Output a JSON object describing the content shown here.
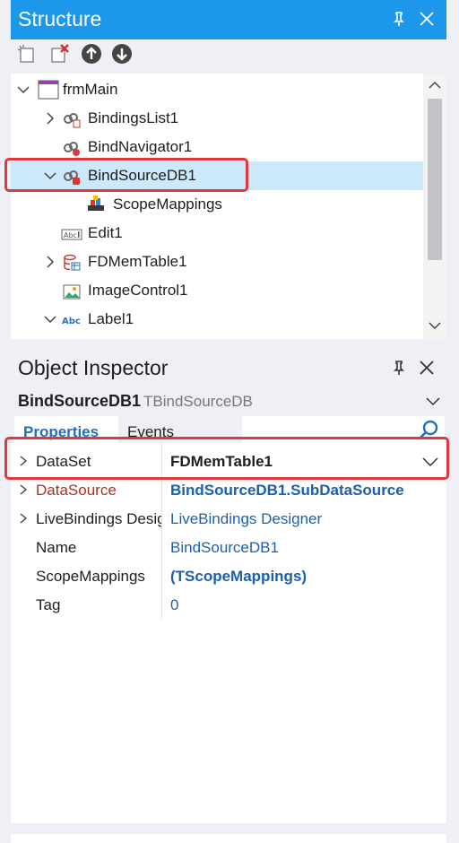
{
  "structure": {
    "title": "Structure",
    "tree": [
      {
        "label": "frmMain"
      },
      {
        "label": "BindingsList1"
      },
      {
        "label": "BindNavigator1"
      },
      {
        "label": "BindSourceDB1"
      },
      {
        "label": "ScopeMappings"
      },
      {
        "label": "Edit1"
      },
      {
        "label": "FDMemTable1"
      },
      {
        "label": "ImageControl1"
      },
      {
        "label": "Label1"
      }
    ]
  },
  "inspector": {
    "title": "Object Inspector",
    "object_name": "BindSourceDB1",
    "object_type": "TBindSourceDB",
    "tabs": {
      "properties": "Properties",
      "events": "Events"
    },
    "properties": [
      {
        "name": "DataSet",
        "value": "FDMemTable1"
      },
      {
        "name": "DataSource",
        "value": "BindSourceDB1.SubDataSource"
      },
      {
        "name": "LiveBindings Designer",
        "value": "LiveBindings Designer"
      },
      {
        "name": "Name",
        "value": "BindSourceDB1"
      },
      {
        "name": "ScopeMappings",
        "value": "(TScopeMappings)"
      },
      {
        "name": "Tag",
        "value": "0"
      }
    ]
  },
  "colors": {
    "accent": "#1c97ea",
    "selection": "#cce8fb",
    "highlight": "#e0383e",
    "link": "#1c5fb0"
  }
}
